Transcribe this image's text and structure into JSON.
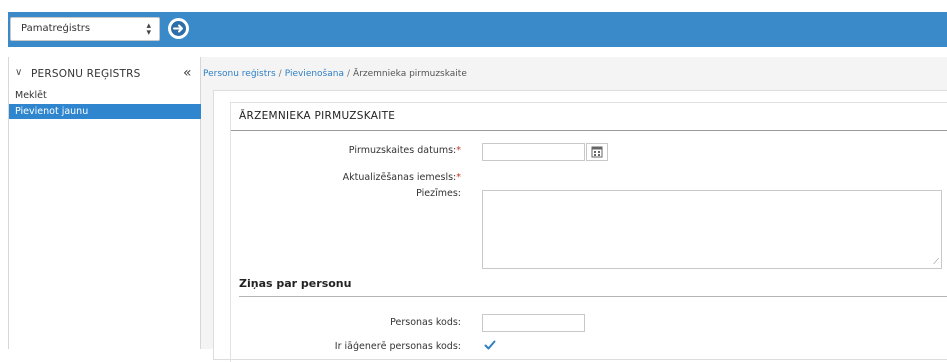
{
  "header": {
    "register_select": "Pamatreģistrs",
    "register_select_arrows": "⬍",
    "accent_color": "#3a89c9"
  },
  "sidebar": {
    "title": "PERSONU REĢISTRS",
    "items": [
      {
        "label": "Meklēt",
        "active": false
      },
      {
        "label": "Pievienot jaunu",
        "active": true
      }
    ]
  },
  "breadcrumb": {
    "items": [
      "Personu reģistrs",
      "Pievienošana",
      "Ārzemnieka pirmuzskaite"
    ],
    "separator": "/"
  },
  "form": {
    "title": "ĀRZEMNIEKA PIRMUZSKAITE",
    "fields": {
      "date_label": "Pirmuzskaites datums:",
      "date_value": "",
      "reason_label": "Aktualizēšanas iemesls:",
      "notes_label": "Piezīmes:",
      "notes_value": ""
    },
    "required_marker": "*",
    "person_section": {
      "title": "Ziņas par personu",
      "personal_code_label": "Personas kods:",
      "personal_code_value": "",
      "generated_label": "Ir iāģenerē personas kods:",
      "generated_checked": true
    }
  }
}
